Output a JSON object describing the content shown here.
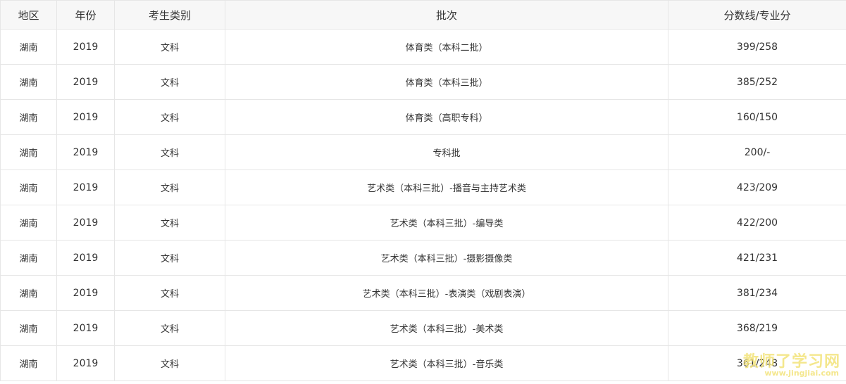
{
  "table": {
    "headers": [
      "地区",
      "年份",
      "考生类别",
      "批次",
      "分数线/专业分"
    ],
    "rows": [
      {
        "region": "湖南",
        "year": "2019",
        "type": "文科",
        "batch": "体育类（本科二批）",
        "score": "399/258"
      },
      {
        "region": "湖南",
        "year": "2019",
        "type": "文科",
        "batch": "体育类（本科三批）",
        "score": "385/252"
      },
      {
        "region": "湖南",
        "year": "2019",
        "type": "文科",
        "batch": "体育类（高职专科）",
        "score": "160/150"
      },
      {
        "region": "湖南",
        "year": "2019",
        "type": "文科",
        "batch": "专科批",
        "score": "200/-"
      },
      {
        "region": "湖南",
        "year": "2019",
        "type": "文科",
        "batch": "艺术类（本科三批）-播音与主持艺术类",
        "score": "423/209"
      },
      {
        "region": "湖南",
        "year": "2019",
        "type": "文科",
        "batch": "艺术类（本科三批）-编导类",
        "score": "422/200"
      },
      {
        "region": "湖南",
        "year": "2019",
        "type": "文科",
        "batch": "艺术类（本科三批）-摄影摄像类",
        "score": "421/231"
      },
      {
        "region": "湖南",
        "year": "2019",
        "type": "文科",
        "batch": "艺术类（本科三批）-表演类（戏剧表演）",
        "score": "381/234"
      },
      {
        "region": "湖南",
        "year": "2019",
        "type": "文科",
        "batch": "艺术类（本科三批）-美术类",
        "score": "368/219"
      },
      {
        "region": "湖南",
        "year": "2019",
        "type": "文科",
        "batch": "艺术类（本科三批）-音乐类",
        "score": "361/248"
      }
    ]
  },
  "watermark": {
    "main": "教师了学习网",
    "sub": "www.jingjiai.com"
  }
}
